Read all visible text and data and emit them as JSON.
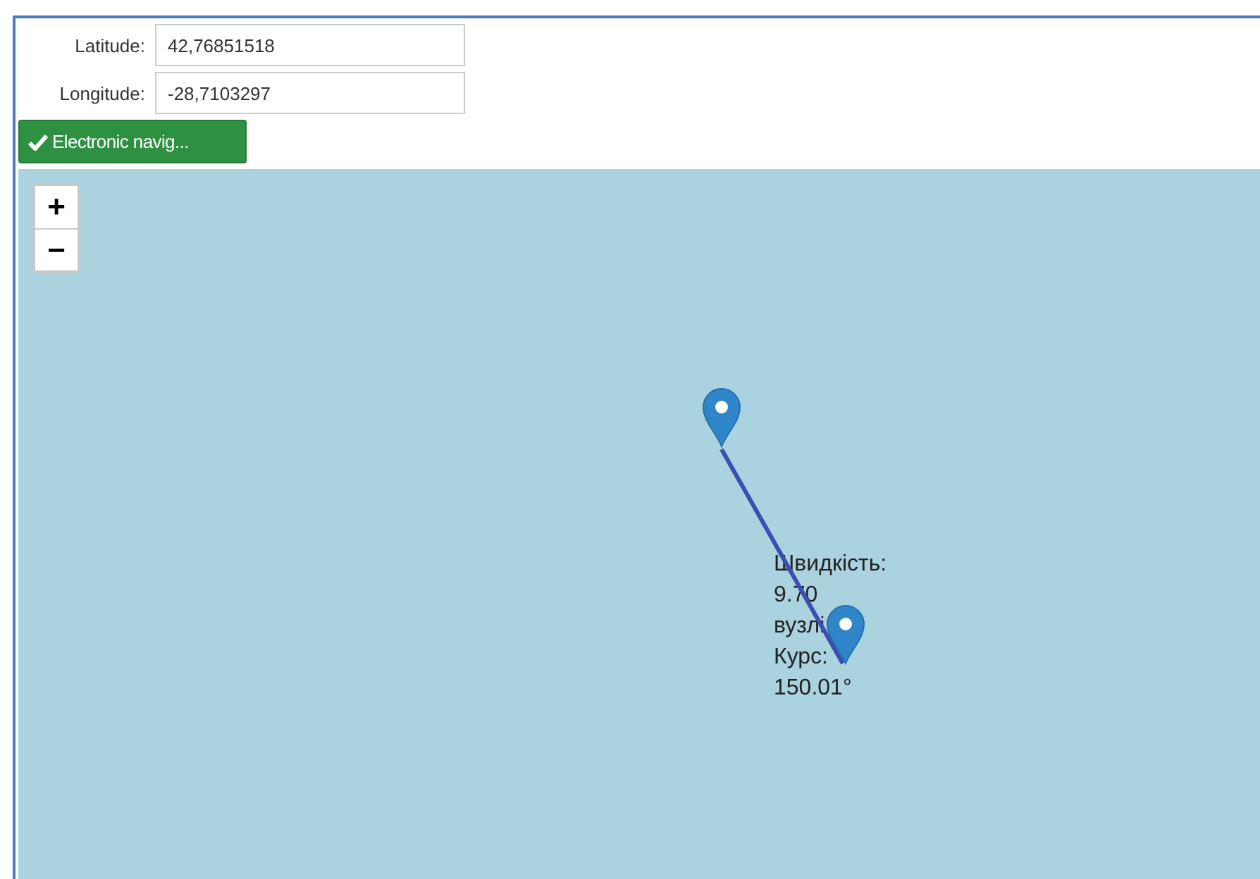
{
  "form": {
    "fields": [
      {
        "label": "Latitude:",
        "value": "42,76851518"
      },
      {
        "label": "Longitude:",
        "value": "-28,7103297"
      }
    ],
    "button": {
      "label": "Electronic navig..."
    }
  },
  "map": {
    "zoom_in": "+",
    "zoom_out": "−",
    "label_lines": [
      "Швидкість:",
      "9.70",
      "вузлі",
      "Курс:",
      "150.01°"
    ]
  }
}
